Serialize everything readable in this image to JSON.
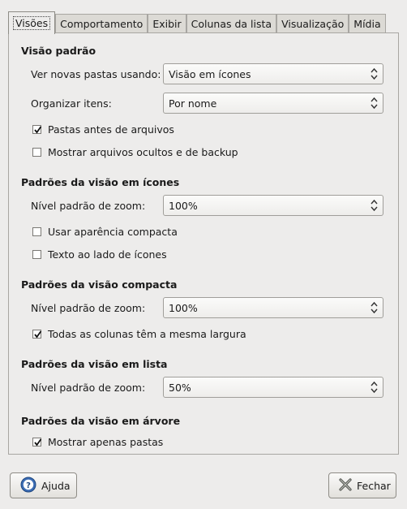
{
  "tabs": [
    {
      "label": "Visões"
    },
    {
      "label": "Comportamento"
    },
    {
      "label": "Exibir"
    },
    {
      "label": "Colunas da lista"
    },
    {
      "label": "Visualização"
    },
    {
      "label": "Mídia"
    }
  ],
  "default_view": {
    "title": "Visão padrão",
    "new_folders_label": "Ver novas pastas usando:",
    "new_folders_value": "Visão em ícones",
    "arrange_label": "Organizar itens:",
    "arrange_value": "Por nome",
    "folders_before_files": {
      "label": "Pastas antes de arquivos",
      "checked": true
    },
    "show_hidden": {
      "label": "Mostrar arquivos ocultos e de backup",
      "checked": false
    }
  },
  "icon_view": {
    "title": "Padrões da visão em ícones",
    "zoom_label": "Nível padrão de zoom:",
    "zoom_value": "100%",
    "compact_layout": {
      "label": "Usar aparência compacta",
      "checked": false
    },
    "text_beside_icons": {
      "label": "Texto ao lado de ícones",
      "checked": false
    }
  },
  "compact_view": {
    "title": "Padrões da visão compacta",
    "zoom_label": "Nível padrão de zoom:",
    "zoom_value": "100%",
    "same_width": {
      "label": "Todas as colunas têm a mesma largura",
      "checked": true
    }
  },
  "list_view": {
    "title": "Padrões da visão em lista",
    "zoom_label": "Nível padrão de zoom:",
    "zoom_value": "50%"
  },
  "tree_view": {
    "title": "Padrões da visão em árvore",
    "only_folders": {
      "label": "Mostrar apenas pastas",
      "checked": true
    }
  },
  "buttons": {
    "help": "Ajuda",
    "close": "Fechar"
  },
  "colors": {
    "background": "#edeceb",
    "help_icon": "#3b6cb4",
    "close_icon": "#555753"
  }
}
